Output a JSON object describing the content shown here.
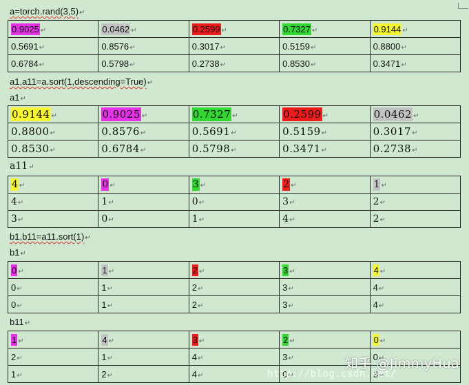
{
  "colors": {
    "magenta": "#e632e6",
    "gray": "#c3c3c3",
    "red": "#ee1c1c",
    "green": "#33d633",
    "yellow": "#f5f532",
    "page_background": "#cfe8cf"
  },
  "code": {
    "line_a": "a=torch.rand(3,5)",
    "line_sort": "a1,a11=a.sort(1,descending=True)",
    "label_a1": "a1",
    "label_a11": "a11",
    "line_sort2": "b1,b11=a11.sort(1)",
    "label_b1": "b1",
    "label_b11": "b11"
  },
  "tables": {
    "a": [
      [
        "0.9025",
        "0.0462",
        "0.2599",
        "0.7327",
        "0.9144"
      ],
      [
        "0.5691",
        "0.8576",
        "0.3017",
        "0.5159",
        "0.8800"
      ],
      [
        "0.6784",
        "0.5798",
        "0.2738",
        "0.8530",
        "0.3471"
      ]
    ],
    "a1": [
      [
        "0.9144",
        "0.9025",
        "0.7327",
        "0.2599",
        "0.0462"
      ],
      [
        "0.8800",
        "0.8576",
        "0.5691",
        "0.5159",
        "0.3017"
      ],
      [
        "0.8530",
        "0.6784",
        "0.5798",
        "0.3471",
        "0.2738"
      ]
    ],
    "a11": [
      [
        "4",
        "0",
        "3",
        "2",
        "1"
      ],
      [
        "4",
        "1",
        "0",
        "3",
        "2"
      ],
      [
        "3",
        "0",
        "1",
        "4",
        "2"
      ]
    ],
    "b1": [
      [
        "0",
        "1",
        "2",
        "3",
        "4"
      ],
      [
        "0",
        "1",
        "2",
        "3",
        "4"
      ],
      [
        "0",
        "1",
        "2",
        "3",
        "4"
      ]
    ],
    "b11": [
      [
        "1",
        "4",
        "3",
        "2",
        "0"
      ],
      [
        "2",
        "1",
        "4",
        "3",
        "0"
      ],
      [
        "1",
        "2",
        "4",
        "0",
        "3"
      ]
    ]
  },
  "first_row_highlight": {
    "a": [
      "magenta",
      "gray",
      "red",
      "green",
      "yellow"
    ],
    "a1": [
      "yellow",
      "magenta",
      "green",
      "red",
      "gray"
    ],
    "a11": [
      "yellow",
      "magenta",
      "green",
      "red",
      "gray"
    ],
    "b1": [
      "magenta",
      "gray",
      "red",
      "green",
      "yellow"
    ],
    "b11": [
      "magenta",
      "gray",
      "red",
      "green",
      "yellow"
    ]
  },
  "watermark": {
    "text": "知乎 @JimmyHua",
    "url": "http://blog.csdn.net/"
  }
}
